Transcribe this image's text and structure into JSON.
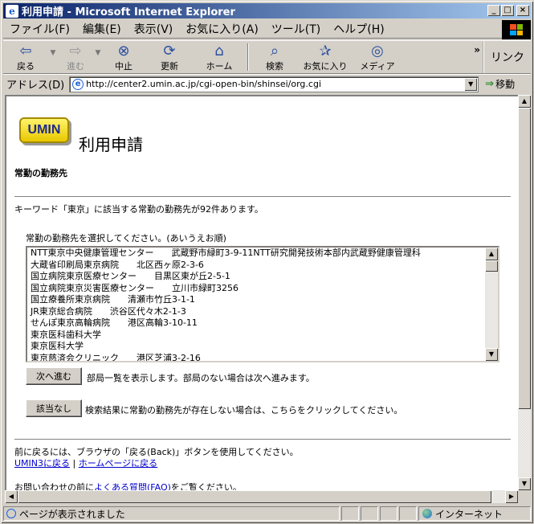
{
  "window": {
    "title": "利用申請 - Microsoft Internet Explorer",
    "controls": [
      "_",
      "□",
      "×"
    ]
  },
  "menu": [
    "ファイル(F)",
    "編集(E)",
    "表示(V)",
    "お気に入り(A)",
    "ツール(T)",
    "ヘルプ(H)"
  ],
  "toolbar": {
    "back": "戻る",
    "forward": "進む",
    "stop": "中止",
    "refresh": "更新",
    "home": "ホーム",
    "search": "検索",
    "favorites": "お気に入り",
    "media": "メディア",
    "links": "リンク",
    "chevron": "»"
  },
  "address": {
    "label": "アドレス(D)",
    "url": "http://center2.umin.ac.jp/cgi-open-bin/shinsei/org.cgi",
    "go": "移動"
  },
  "page": {
    "logo": "UMIN",
    "title": "利用申請",
    "section": "常勤の勤務先",
    "result": "キーワード「東京」に該当する常勤の勤務先が92件あります。",
    "instruct": "常勤の勤務先を選択してください。(あいうえお順)",
    "options": [
      "NTT東京中央健康管理センター　　武蔵野市緑町3-9-11NTT研究開発技術本部内武蔵野健康管理科",
      "大蔵省印刷局東京病院　　北区西ヶ原2-3-6",
      "国立病院東京医療センター　　目黒区東が丘2-5-1",
      "国立病院東京災害医療センター　　立川市緑町3256",
      "国立療養所東京病院　　清瀬市竹丘3-1-1",
      "JR東京総合病院　　渋谷区代々木2-1-3",
      "せんぽ東京高輪病院　　港区高輪3-10-11",
      "東京医科歯科大学",
      "東京医科大学",
      "東京慈済会クリニック　　港区芝浦3-2-16"
    ],
    "next_button": "次へ進む",
    "next_desc": "部局一覧を表示します。部局のない場合は次へ進みます。",
    "none_button": "該当なし",
    "none_desc": "検索結果に常勤の勤務先が存在しない場合は、こちらをクリックしてください。",
    "back_note": "前に戻るには、ブラウザの「戻る(Back)」ボタンを使用してください。",
    "link_umin3": "UMIN3に戻る",
    "link_sep": "|",
    "link_home": "ホームページに戻る",
    "contact_pre": "お問い合わせの前に",
    "contact_link": "よくある質問(FAQ)",
    "contact_post": "をご覧ください。"
  },
  "status": {
    "text": "ページが表示されました",
    "zone": "インターネット"
  }
}
